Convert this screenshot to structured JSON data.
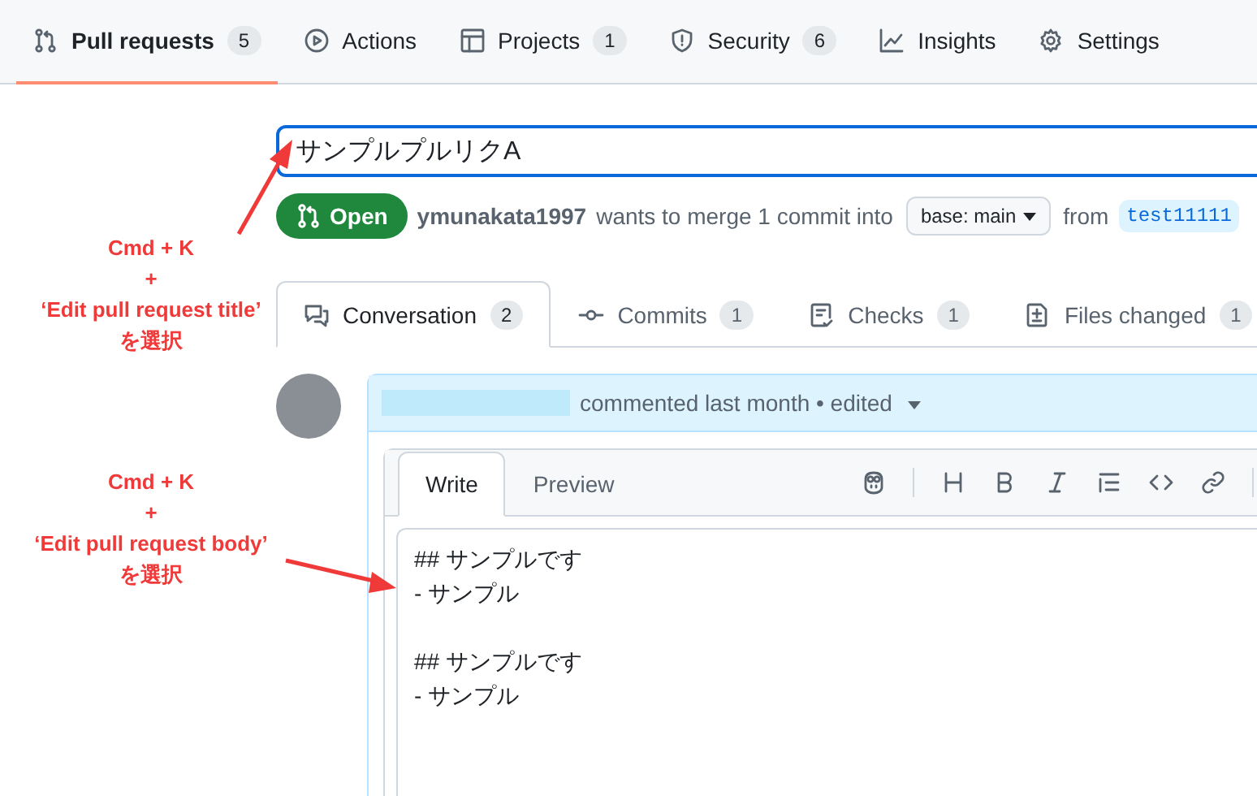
{
  "repo_nav": {
    "tabs": [
      {
        "label": "Pull requests",
        "count": "5",
        "selected": true
      },
      {
        "label": "Actions",
        "selected": false
      },
      {
        "label": "Projects",
        "count": "1",
        "selected": false
      },
      {
        "label": "Security",
        "count": "6",
        "selected": false
      },
      {
        "label": "Insights",
        "selected": false
      },
      {
        "label": "Settings",
        "selected": false
      }
    ]
  },
  "pull_request": {
    "title_field": {
      "value": "サンプルプルリクA"
    },
    "state": "Open",
    "author": "ymunakata1997",
    "merge_text": "wants to merge 1 commit into",
    "base_branch": "base: main",
    "from_text": "from",
    "head_branch": "test11111",
    "tabs": [
      {
        "label": "Conversation",
        "count": "2",
        "selected": true
      },
      {
        "label": "Commits",
        "count": "1",
        "selected": false
      },
      {
        "label": "Checks",
        "count": "1",
        "selected": false
      },
      {
        "label": "Files changed",
        "count": "1",
        "selected": false
      }
    ],
    "comment": {
      "header_text": "commented last month • edited",
      "editor_tabs": [
        {
          "label": "Write",
          "selected": true
        },
        {
          "label": "Preview",
          "selected": false
        }
      ],
      "body_value": "## サンプルです\n- サンプル\n\n## サンプルです\n- サンプル"
    }
  },
  "annotations": [
    {
      "text": "Cmd + K\n+\n‘Edit pull request title’\nを選択"
    },
    {
      "text": "Cmd + K\n+\n‘Edit pull request body’\nを選択"
    }
  ]
}
